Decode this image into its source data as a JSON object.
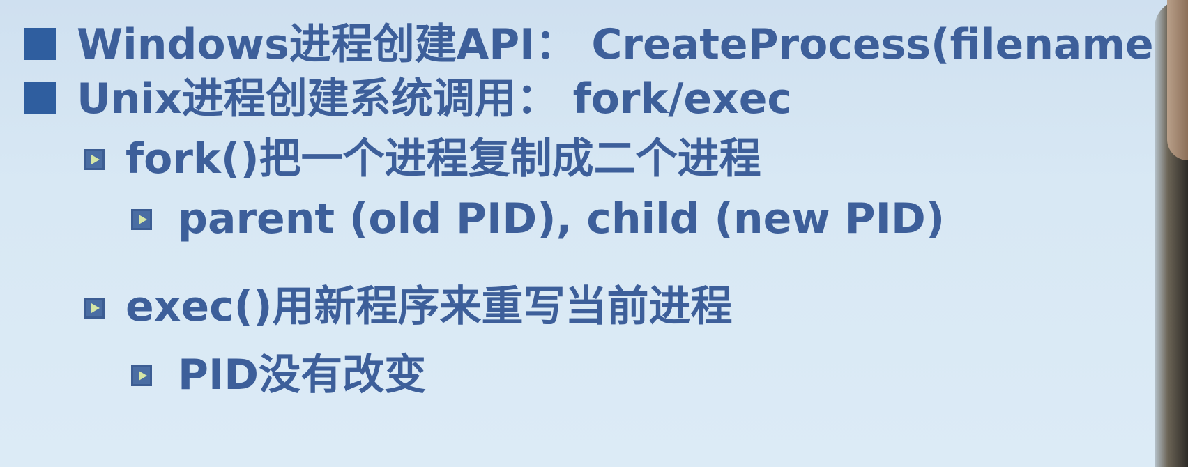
{
  "bullets": [
    {
      "level": 1,
      "text": "Windows进程创建API： CreateProcess(filename)"
    },
    {
      "level": 1,
      "text": "Unix进程创建系统调用： fork/exec"
    },
    {
      "level": 2,
      "text": "fork()把一个进程复制成二个进程"
    },
    {
      "level": 3,
      "text": "parent (old PID), child (new PID)"
    },
    {
      "level": 2,
      "text": "exec()用新程序来重写当前进程"
    },
    {
      "level": 3,
      "text": "PID没有改变"
    }
  ],
  "colors": {
    "text": "#3d5f9a",
    "bullet_square": "#2f5e9f",
    "background": "#d8e8f4"
  }
}
